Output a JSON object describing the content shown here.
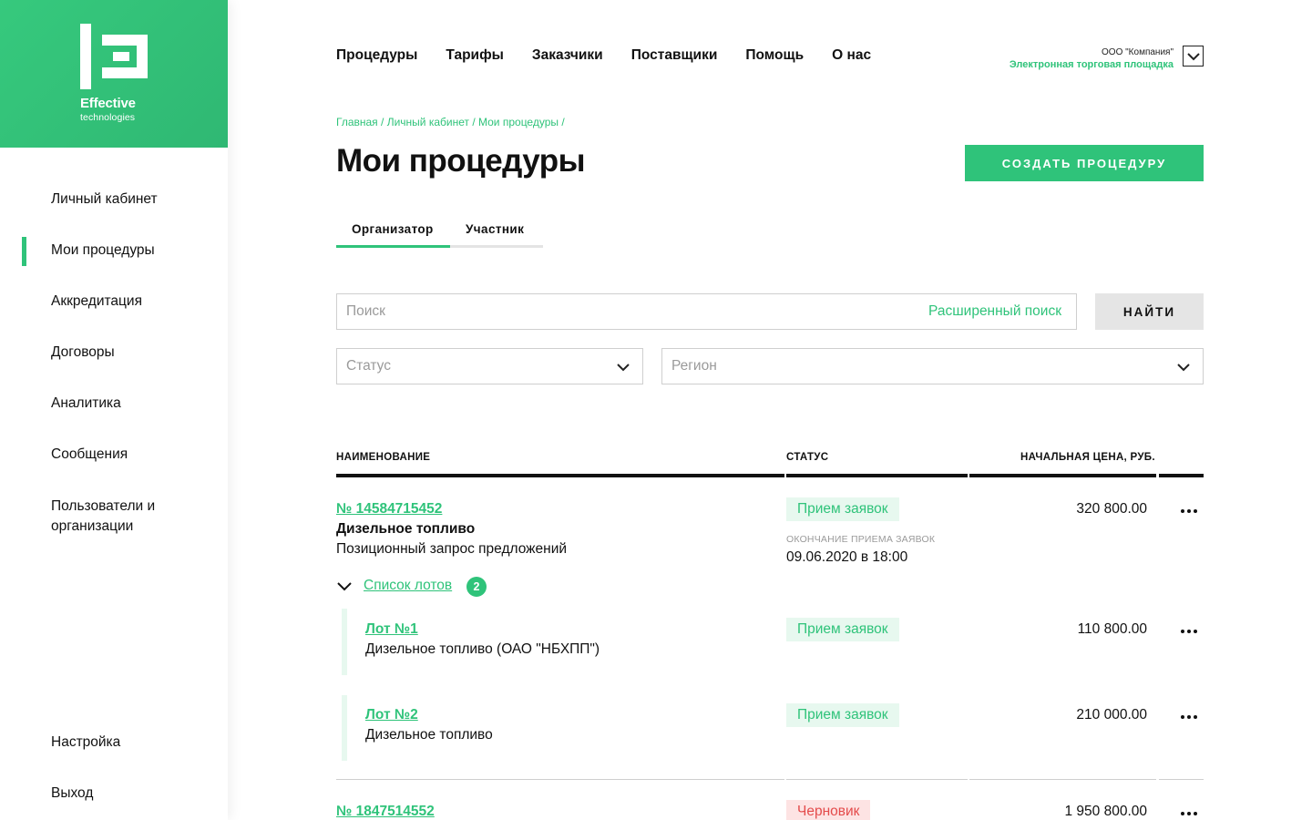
{
  "logo": {
    "line1": "Effective",
    "line2": "technologies"
  },
  "sidebar": {
    "items": [
      {
        "label": "Личный кабинет"
      },
      {
        "label": "Мои процедуры"
      },
      {
        "label": "Аккредитация"
      },
      {
        "label": "Договоры"
      },
      {
        "label": "Аналитика"
      },
      {
        "label": "Сообщения"
      },
      {
        "label": "Пользователи и организации"
      }
    ],
    "bottom": [
      {
        "label": "Настройка"
      },
      {
        "label": "Выход"
      }
    ]
  },
  "topnav": [
    "Процедуры",
    "Тарифы",
    "Заказчики",
    "Поставщики",
    "Помощь",
    "О нас"
  ],
  "company": {
    "name": "ООО \"Компания\"",
    "subtitle": "Электронная торговая площадка"
  },
  "breadcrumb": [
    "Главная",
    "Личный кабинет",
    "Мои процедуры"
  ],
  "page_title": "Мои процедуры",
  "create_button": "СОЗДАТЬ ПРОЦЕДУРУ",
  "tabs": [
    "Организатор",
    "Участник"
  ],
  "search": {
    "placeholder": "Поиск",
    "advanced": "Расширенный поиск",
    "button": "НАЙТИ"
  },
  "filters": {
    "status_placeholder": "Статус",
    "region_placeholder": "Регион"
  },
  "table": {
    "headers": {
      "name": "НАИМЕНОВАНИЕ",
      "status": "СТАТУС",
      "price": "НАЧАЛЬНАЯ ЦЕНА, РУБ."
    },
    "rows": [
      {
        "number": "№ 14584715452",
        "name": "Дизельное топливо",
        "type": "Позиционный запрос предложений",
        "status": "Прием заявок",
        "deadline_label": "ОКОНЧАНИЕ ПРИЕМА ЗАЯВОК",
        "deadline": "09.06.2020 в 18:00",
        "price": "320 800.00",
        "lots_label": "Список лотов",
        "lots_count": "2",
        "lots": [
          {
            "number": "Лот №1",
            "name": "Дизельное топливо (ОАО \"НБХПП\")",
            "status": "Прием заявок",
            "price": "110 800.00"
          },
          {
            "number": "Лот №2",
            "name": "Дизельное топливо",
            "status": "Прием заявок",
            "price": "210 000.00"
          }
        ]
      },
      {
        "number": "№ 1847514552",
        "status": "Черновик",
        "price": "1 950 800.00"
      }
    ]
  },
  "colors": {
    "accent": "#2fc37a",
    "draft": "#e44b4b"
  }
}
